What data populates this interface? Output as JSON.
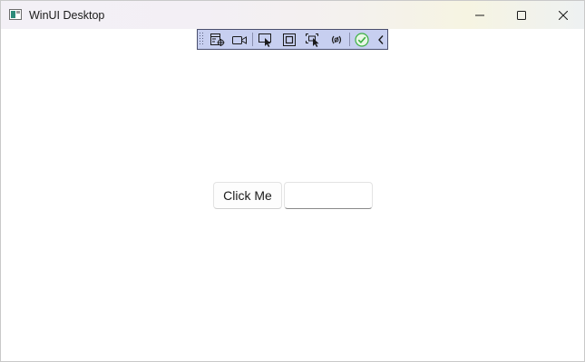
{
  "window": {
    "title": "WinUI Desktop"
  },
  "titlebar": {
    "app_icon": "app-window-icon",
    "buttons": {
      "minimize_icon": "minimize-icon",
      "maximize_icon": "maximize-icon",
      "close_icon": "close-icon"
    }
  },
  "debug_toolbar": {
    "background": "#c7cff0",
    "items": [
      {
        "icon": "live-visual-tree-icon"
      },
      {
        "icon": "record-video-icon"
      },
      {
        "icon": "select-element-icon"
      },
      {
        "icon": "display-layout-adorners-icon"
      },
      {
        "icon": "track-focused-element-icon"
      },
      {
        "icon": "binding-failures-icon"
      },
      {
        "icon": "accessibility-check-icon"
      },
      {
        "icon": "collapse-toolbar-icon"
      }
    ]
  },
  "content": {
    "button_label": "Click Me",
    "input_value": "",
    "input_placeholder": ""
  },
  "colors": {
    "check_green": "#3cb043"
  }
}
